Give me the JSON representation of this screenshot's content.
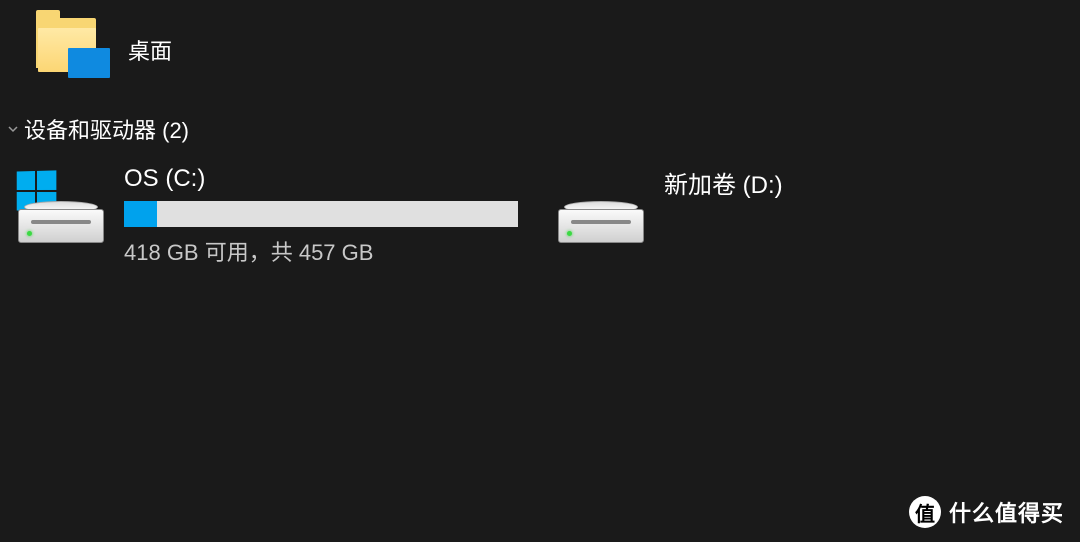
{
  "folders": {
    "desktop": {
      "label": "桌面"
    }
  },
  "section": {
    "title": "设备和驱动器 (2)"
  },
  "drives": [
    {
      "name": "OS (C:)",
      "usage_text": "418 GB 可用，共 457 GB",
      "used_percent": "8.5%",
      "has_os_logo": true
    },
    {
      "name": "新加卷 (D:)",
      "usage_text": "",
      "used_percent": "",
      "has_os_logo": false
    }
  ],
  "watermark": {
    "badge": "值",
    "text": "什么值得买"
  }
}
